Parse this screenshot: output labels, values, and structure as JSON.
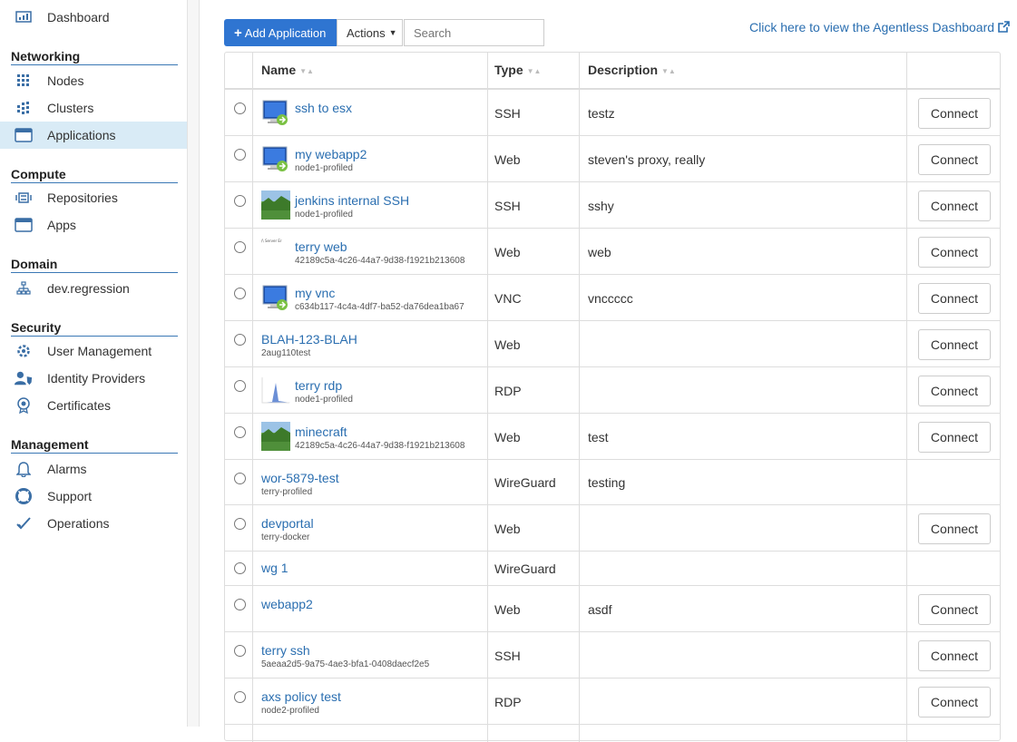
{
  "sidebar": {
    "top_items": [
      {
        "label": "Dashboard",
        "icon": "dashboard-icon"
      }
    ],
    "sections": [
      {
        "title": "Networking",
        "items": [
          {
            "label": "Nodes",
            "icon": "nodes-icon"
          },
          {
            "label": "Clusters",
            "icon": "clusters-icon"
          },
          {
            "label": "Applications",
            "icon": "applications-icon",
            "active": true
          }
        ]
      },
      {
        "title": "Compute",
        "items": [
          {
            "label": "Repositories",
            "icon": "repositories-icon"
          },
          {
            "label": "Apps",
            "icon": "apps-icon"
          }
        ]
      },
      {
        "title": "Domain",
        "items": [
          {
            "label": "dev.regression",
            "icon": "domain-tree-icon"
          }
        ]
      },
      {
        "title": "Security",
        "items": [
          {
            "label": "User Management",
            "icon": "user-management-icon"
          },
          {
            "label": "Identity Providers",
            "icon": "identity-providers-icon"
          },
          {
            "label": "Certificates",
            "icon": "certificates-icon"
          }
        ]
      },
      {
        "title": "Management",
        "items": [
          {
            "label": "Alarms",
            "icon": "bell-icon"
          },
          {
            "label": "Support",
            "icon": "lifebuoy-icon"
          },
          {
            "label": "Operations",
            "icon": "checkmark-icon"
          }
        ]
      }
    ]
  },
  "toolbar": {
    "add_label": "Add Application",
    "actions_label": "Actions",
    "search_placeholder": "Search",
    "agentless_link": "Click here to view the Agentless Dashboard"
  },
  "table": {
    "columns": [
      "Name",
      "Type",
      "Description"
    ],
    "connect_label": "Connect",
    "rows": [
      {
        "name": "ssh to esx",
        "sub": "",
        "type": "SSH",
        "description": "testz",
        "thumb": "remote-desktop-icon",
        "connect": true
      },
      {
        "name": "my webapp2",
        "sub": "node1-profiled",
        "type": "Web",
        "description": "steven's proxy, really",
        "thumb": "remote-desktop-icon",
        "connect": true
      },
      {
        "name": "jenkins internal SSH",
        "sub": "node1-profiled",
        "type": "SSH",
        "description": "sshy",
        "thumb": "landscape-thumbnail",
        "connect": true
      },
      {
        "name": "terry web",
        "sub": "42189c5a-4c26-44a7-9d38-f1921b213608",
        "type": "Web",
        "description": "web",
        "thumb": "server-text-thumbnail",
        "connect": true
      },
      {
        "name": "my vnc",
        "sub": "c634b117-4c4a-4df7-ba52-da76dea1ba67",
        "type": "VNC",
        "description": "vnccccc",
        "thumb": "remote-desktop-icon",
        "connect": true
      },
      {
        "name": "BLAH-123-BLAH",
        "sub": "2aug110test",
        "type": "Web",
        "description": "",
        "thumb": "",
        "connect": true
      },
      {
        "name": "terry rdp",
        "sub": "node1-profiled",
        "type": "RDP",
        "description": "",
        "thumb": "graph-thumbnail",
        "connect": true
      },
      {
        "name": "minecraft",
        "sub": "42189c5a-4c26-44a7-9d38-f1921b213608",
        "type": "Web",
        "description": "test",
        "thumb": "landscape-thumbnail",
        "connect": true
      },
      {
        "name": "wor-5879-test",
        "sub": "terry-profiled",
        "type": "WireGuard",
        "description": "testing",
        "thumb": "",
        "connect": false
      },
      {
        "name": "devportal",
        "sub": "terry-docker",
        "type": "Web",
        "description": "",
        "thumb": "",
        "connect": true
      },
      {
        "name": "wg 1",
        "sub": "",
        "type": "WireGuard",
        "description": "",
        "thumb": "",
        "connect": false
      },
      {
        "name": "webapp2",
        "sub": "",
        "type": "Web",
        "description": "asdf",
        "thumb": "",
        "connect": true
      },
      {
        "name": "terry ssh",
        "sub": "5aeaa2d5-9a75-4ae3-bfa1-0408daecf2e5",
        "type": "SSH",
        "description": "",
        "thumb": "",
        "connect": true
      },
      {
        "name": "axs policy test",
        "sub": "node2-profiled",
        "type": "RDP",
        "description": "",
        "thumb": "",
        "connect": true
      }
    ]
  },
  "colors": {
    "accent": "#2f75d1",
    "link": "#2a6eb0",
    "active_bg": "#d9ebf6"
  }
}
